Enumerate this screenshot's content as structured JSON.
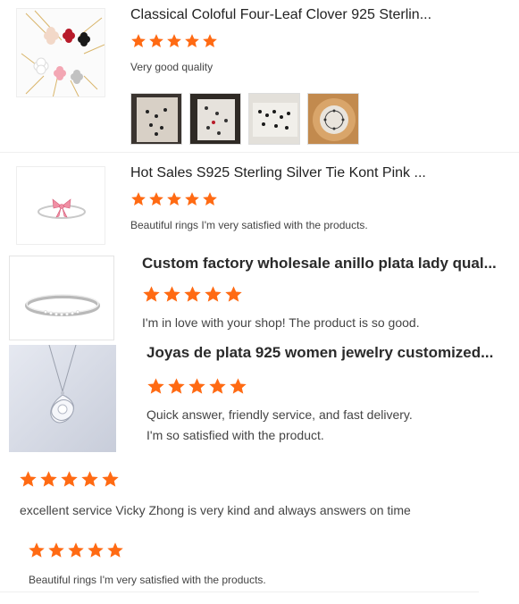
{
  "colors": {
    "star": "#ff6a13",
    "title": "#222222",
    "comment": "#444444"
  },
  "reviews": [
    {
      "product_title": "Classical Coloful Four-Leaf Clover 925 Sterlin...",
      "rating": 5,
      "comment": "Very good quality",
      "thumbnail_icon": "clover-necklace-image",
      "photo_count": 4
    },
    {
      "product_title": "Hot Sales S925 Sterling Silver Tie Kont Pink ...",
      "rating": 5,
      "comment": "Beautiful rings I'm very satisfied with the products.",
      "thumbnail_icon": "bow-ring-image"
    },
    {
      "product_title": "Custom factory wholesale anillo plata lady qual...",
      "rating": 5,
      "comment": "I'm in love with your shop! The product is so good.",
      "thumbnail_icon": "silver-band-ring-image"
    },
    {
      "product_title": "Joyas de plata 925 women jewelry customized...",
      "rating": 5,
      "comment_lines": [
        "Quick answer, friendly service, and fast delivery.",
        "I'm so satisfied with the product."
      ],
      "thumbnail_icon": "silver-pendant-image"
    },
    {
      "rating": 5,
      "comment": "excellent service Vicky Zhong is very kind and always answers on time"
    },
    {
      "rating": 5,
      "comment": "Beautiful rings I'm very satisfied with the products."
    }
  ]
}
